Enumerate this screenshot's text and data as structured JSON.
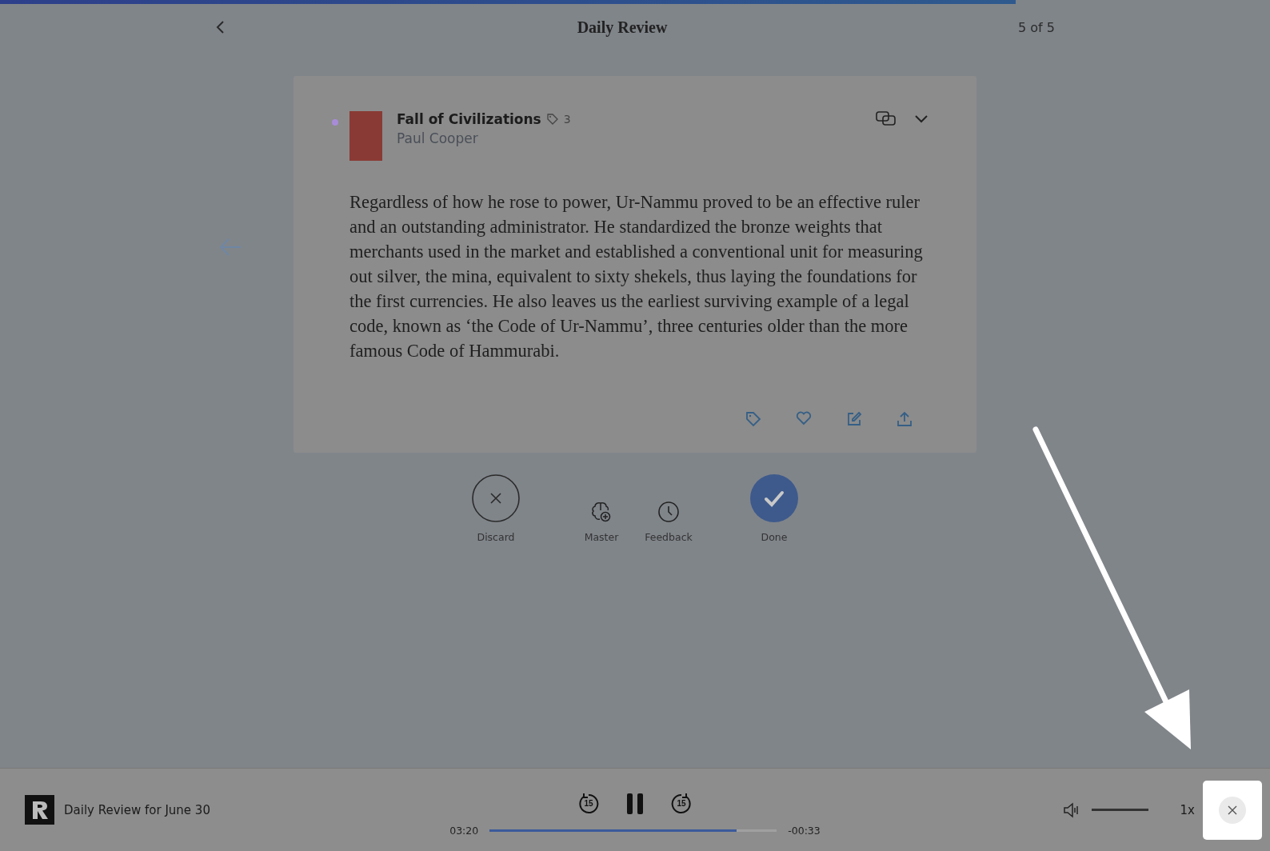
{
  "progress": {
    "level": 0.8
  },
  "header": {
    "title": "Daily Review",
    "counter": "5 of 5"
  },
  "highlight": {
    "book_title": "Fall of Civilizations",
    "tag_count": "3",
    "author": "Paul Cooper",
    "text": "Regardless of how he rose to power, Ur-Nammu proved to be an effective ruler and an outstanding administrator. He standardized the bronze weights that merchants used in the market and established a conventional unit for measuring out silver, the mina, equivalent to sixty shekels, thus laying the foundations for the first currencies. He also leaves us the earliest surviving example of a legal code, known as ‘the Code of Ur-Nammu’, three centuries older than the more famous Code of Hammurabi."
  },
  "review_actions": [
    {
      "kind": "discard",
      "label": "Discard"
    },
    {
      "kind": "master",
      "label": "Master"
    },
    {
      "kind": "feedback",
      "label": "Feedback"
    },
    {
      "kind": "done",
      "label": "Done"
    }
  ],
  "player": {
    "title": "Daily Review for June 30",
    "elapsed": "03:20",
    "remaining": "-00:33",
    "level": 0.86,
    "volume": {
      "level": 1
    },
    "speed": "1x",
    "rewind": "15",
    "forward": "15"
  }
}
